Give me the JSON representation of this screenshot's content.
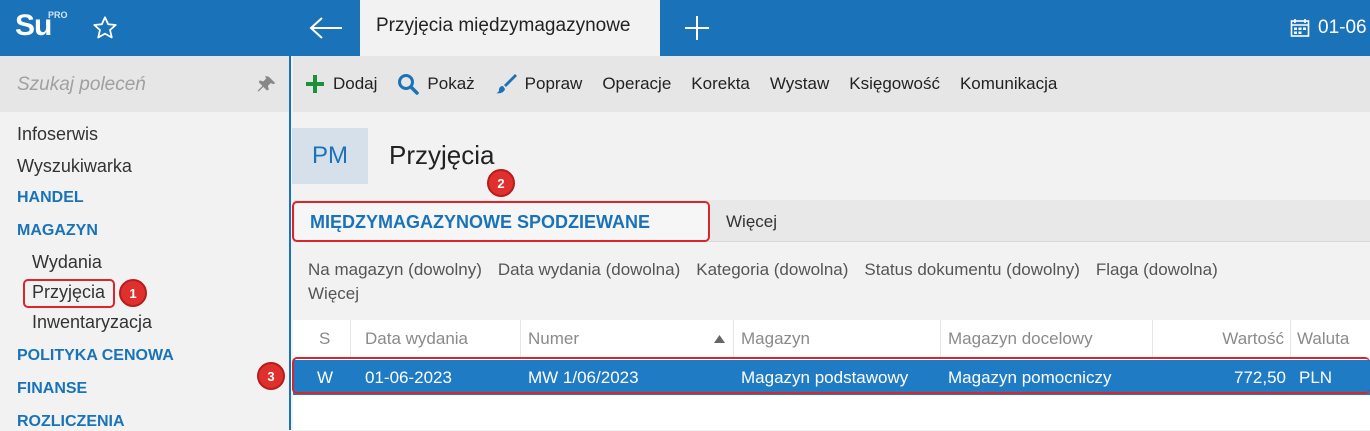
{
  "app": {
    "logo_text": "Su",
    "logo_sup": "PRO",
    "active_tab": "Przyjęcia międzymagazynowe",
    "date": "01-06"
  },
  "sidebar": {
    "search_placeholder": "Szukaj poleceń",
    "items": [
      {
        "label": "Infoserwis"
      },
      {
        "label": "Wyszukiwarka"
      },
      {
        "label": "HANDEL"
      },
      {
        "label": "MAGAZYN"
      },
      {
        "label": "Wydania"
      },
      {
        "label": "Przyjęcia"
      },
      {
        "label": "Inwentaryzacja"
      },
      {
        "label": "POLITYKA CENOWA"
      },
      {
        "label": "FINANSE"
      },
      {
        "label": "ROZLICZENIA"
      }
    ]
  },
  "toolbar": {
    "add": "Dodaj",
    "show": "Pokaż",
    "edit": "Popraw",
    "operations": "Operacje",
    "correction": "Korekta",
    "issue": "Wystaw",
    "accounting": "Księgowość",
    "communication": "Komunikacja"
  },
  "header": {
    "badge": "PM",
    "title": "Przyjęcia"
  },
  "views": {
    "active": "MIĘDZYMAGAZYNOWE SPODZIEWANE",
    "more": "Więcej"
  },
  "filters": [
    "Na magazyn (dowolny)",
    "Data wydania (dowolna)",
    "Kategoria (dowolna)",
    "Status dokumentu (dowolny)",
    "Flaga (dowolna)",
    "Więcej"
  ],
  "table": {
    "columns": [
      "S",
      "Data wydania",
      "Numer",
      "Magazyn",
      "Magazyn docelowy",
      "Wartość",
      "Waluta"
    ],
    "rows": [
      {
        "s": "W",
        "date": "01-06-2023",
        "number": "MW 1/06/2023",
        "warehouse": "Magazyn podstawowy",
        "target": "Magazyn pomocniczy",
        "value": "772,50",
        "currency": "PLN"
      }
    ]
  },
  "annotations": [
    "1",
    "2",
    "3"
  ],
  "colors": {
    "accent": "#1a73b8",
    "selected_row": "#1e7bc4",
    "highlight": "#d9262b"
  }
}
